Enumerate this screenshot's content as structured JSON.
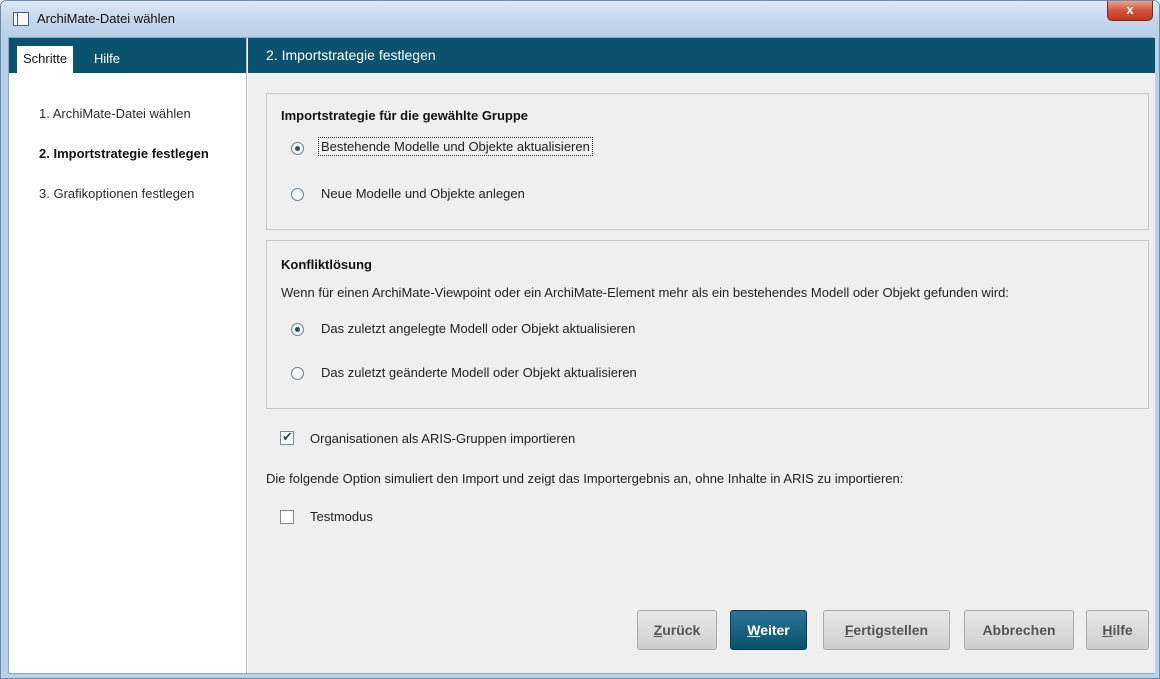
{
  "window": {
    "title": "ArchiMate-Datei wählen",
    "close_label": "x"
  },
  "tabs": [
    {
      "label": "Schritte",
      "active": true
    },
    {
      "label": "Hilfe",
      "active": false
    }
  ],
  "steps": [
    {
      "label": "1. ArchiMate-Datei wählen",
      "current": false
    },
    {
      "label": "2. Importstrategie festlegen",
      "current": true
    },
    {
      "label": "3. Grafikoptionen festlegen",
      "current": false
    }
  ],
  "header": {
    "title": "2. Importstrategie festlegen"
  },
  "strategy": {
    "title": "Importstrategie für die gewählte Gruppe",
    "options": [
      {
        "label": "Bestehende Modelle und Objekte aktualisieren",
        "selected": true
      },
      {
        "label": "Neue Modelle und Objekte anlegen",
        "selected": false
      }
    ]
  },
  "conflict": {
    "title": "Konfliktlösung",
    "description": "Wenn für einen ArchiMate-Viewpoint oder ein ArchiMate-Element mehr als ein bestehendes Modell oder Objekt gefunden wird:",
    "options": [
      {
        "label": "Das zuletzt angelegte Modell oder Objekt aktualisieren",
        "selected": true
      },
      {
        "label": "Das zuletzt geänderte Modell oder Objekt aktualisieren",
        "selected": false
      }
    ]
  },
  "options": {
    "org_groups": {
      "label": "Organisationen als ARIS-Gruppen importieren",
      "checked": true
    },
    "simulation_note": "Die folgende Option simuliert den Import und zeigt das Importergebnis an, ohne Inhalte in ARIS zu importieren:",
    "test_mode": {
      "label": "Testmodus",
      "checked": false
    }
  },
  "buttons": {
    "back": {
      "mnemonic": "Z",
      "rest": "urück"
    },
    "next": {
      "mnemonic": "W",
      "rest": "eiter"
    },
    "finish": {
      "mnemonic": "F",
      "rest": "ertigstellen"
    },
    "cancel": {
      "label": "Abbrechen"
    },
    "help": {
      "mnemonic": "H",
      "rest": "ilfe"
    }
  },
  "colors": {
    "accent": "#0b526e",
    "panel_bg": "#efefef",
    "window_frame": "#b9d1ea",
    "close_red": "#c0391f"
  },
  "icons": {
    "window_icon": "window-icon",
    "close": "close-icon",
    "radio": "radio-icon",
    "checkbox": "checkbox-icon"
  }
}
